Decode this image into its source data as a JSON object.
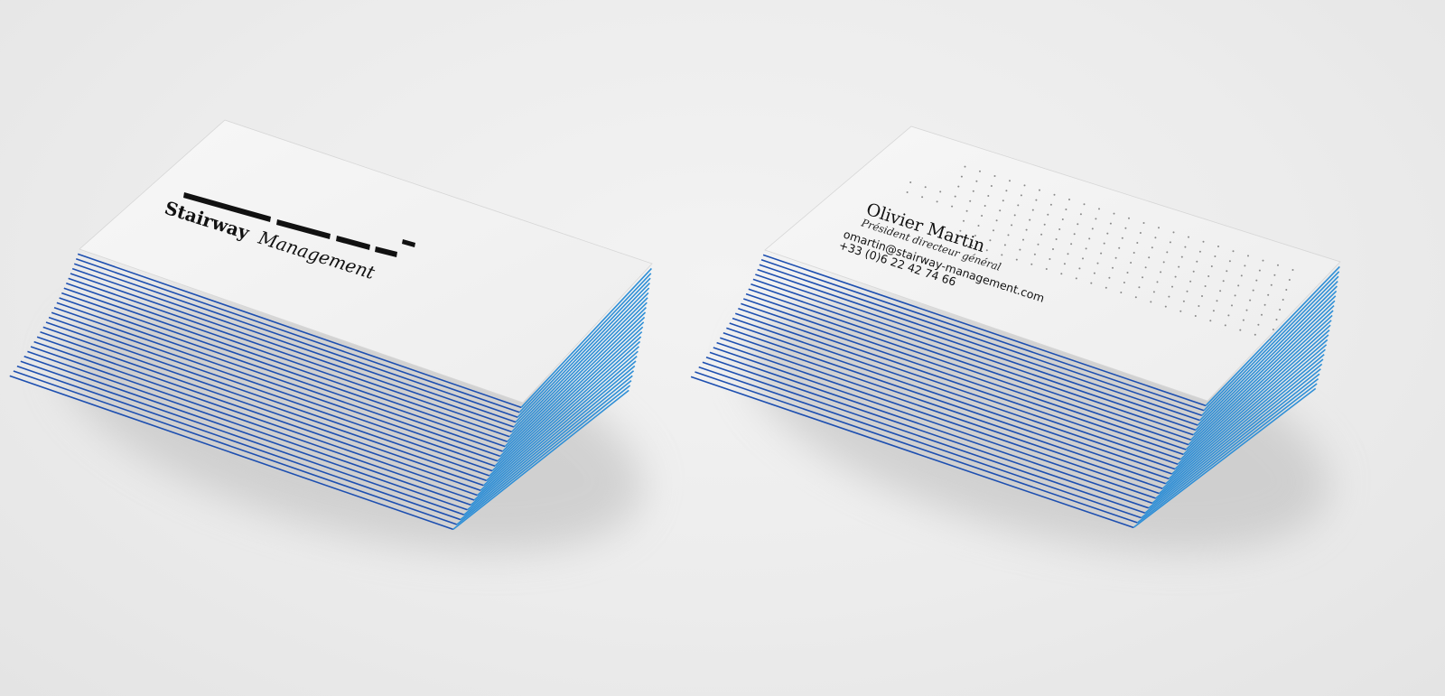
{
  "colors": {
    "background": "#ececec",
    "card_face": "#f4f4f4",
    "edge_blue": "#1d4fb0",
    "edge_cyan": "#2f8fd6",
    "ink": "#111111",
    "dot": "#8a8a8a"
  },
  "front_card": {
    "logo": "Stairway Management",
    "logo_bold": "Stairway",
    "logo_italic": "Management"
  },
  "back_card": {
    "name": "Olivier Martin",
    "title": "Président directeur général",
    "phone": "+33 (0)6 22 42 74 66",
    "email": "omartin@stairway-management.com"
  },
  "icons": {
    "stairs_logo": "stairs-logo-icon",
    "dot_grid": "dot-grid-icon"
  }
}
